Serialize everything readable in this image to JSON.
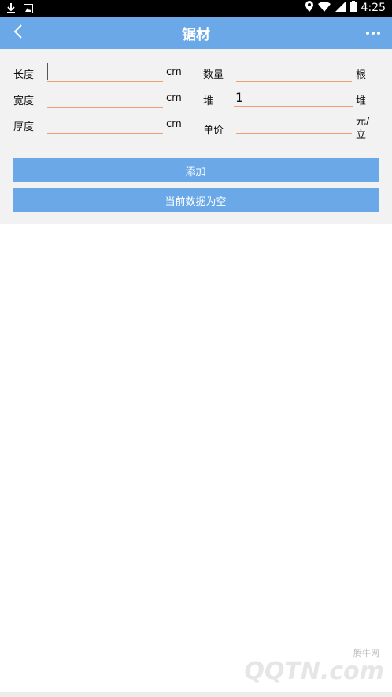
{
  "status_bar": {
    "time": "4:25",
    "left_icons": [
      "download-icon",
      "photo-icon"
    ],
    "right_icons": [
      "location-icon",
      "wifi-icon",
      "signal-icon",
      "battery-icon"
    ]
  },
  "app_bar": {
    "title": "锯材",
    "back_icon": "chevron-left-icon",
    "more_icon": "more-dots-icon"
  },
  "form": {
    "length": {
      "label": "长度",
      "value": "",
      "unit": "cm"
    },
    "width": {
      "label": "宽度",
      "value": "",
      "unit": "cm"
    },
    "thickness": {
      "label": "厚度",
      "value": "",
      "unit": "cm"
    },
    "quantity": {
      "label": "数量",
      "value": "",
      "unit": "根"
    },
    "pile": {
      "label": "堆",
      "value": "1",
      "unit": "堆"
    },
    "unit_price": {
      "label": "单价",
      "value": "",
      "unit_line1": "元/",
      "unit_line2": "立"
    }
  },
  "buttons": {
    "add": "添加",
    "status": "当前数据为空"
  },
  "watermark": {
    "small": "腾牛网",
    "big": "QQTN.com"
  },
  "colors": {
    "accent": "#6aa8e8",
    "field_underline": "#f0a070",
    "panel_bg": "#f2f2f2"
  }
}
